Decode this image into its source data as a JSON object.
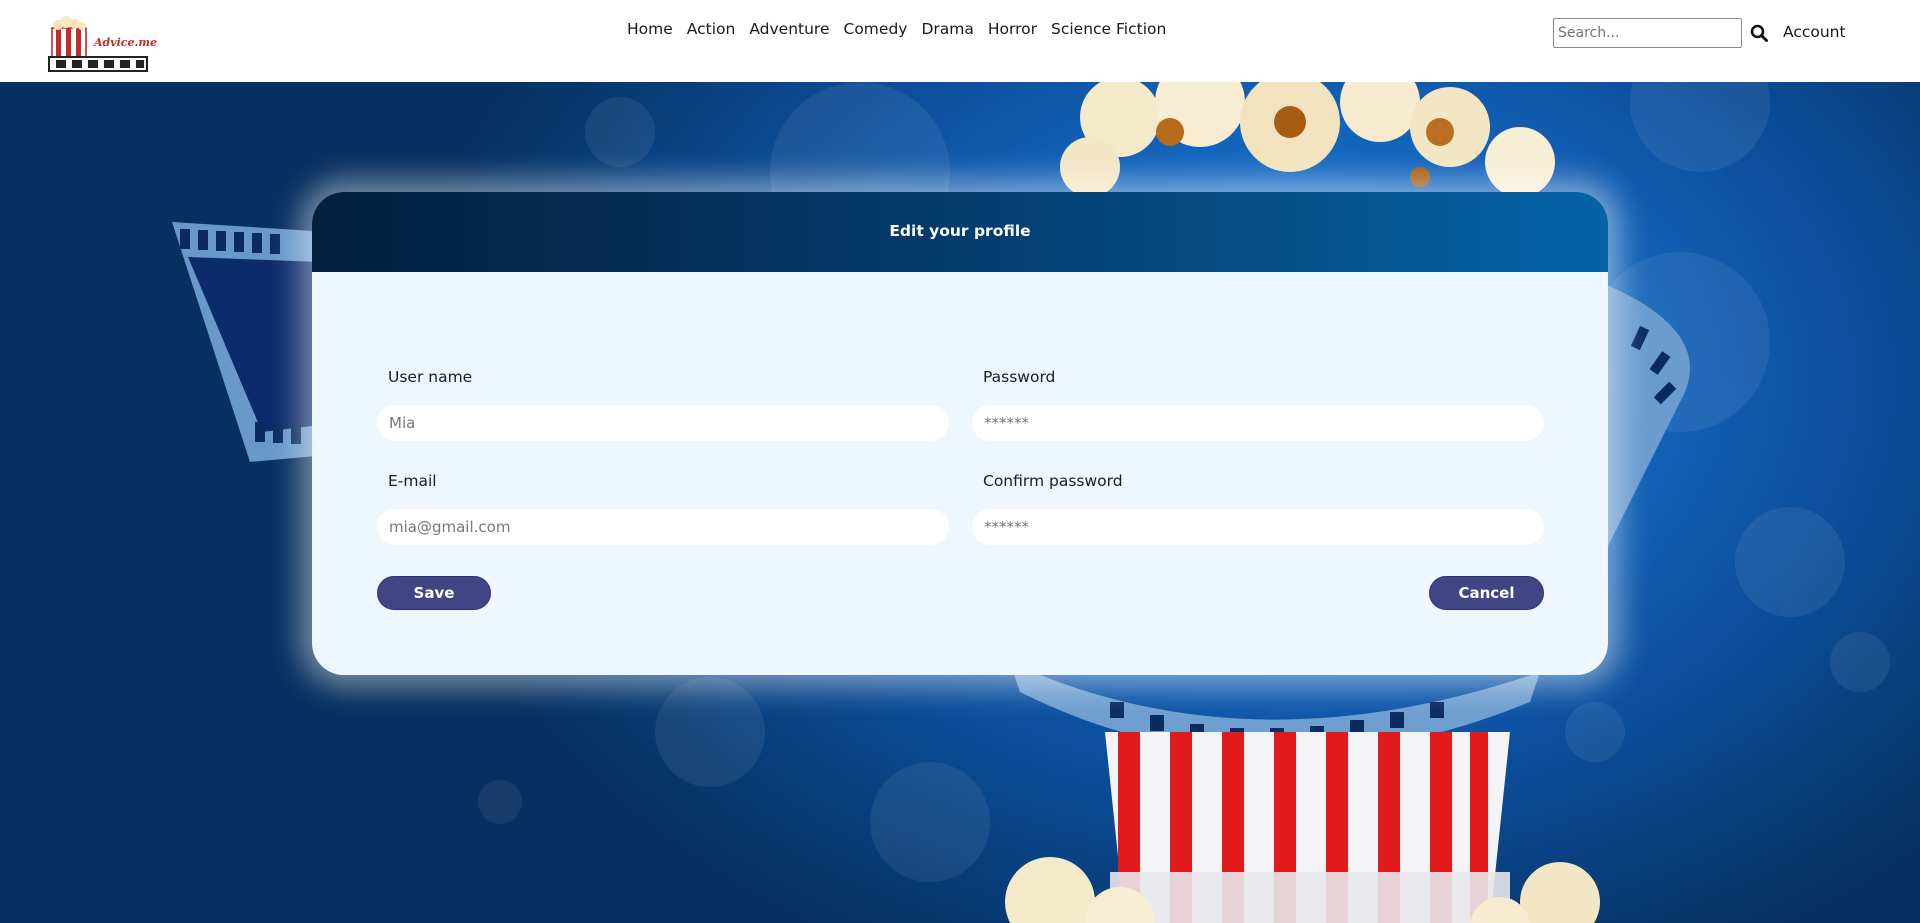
{
  "logo": {
    "text": "Advice.me"
  },
  "nav": {
    "items": [
      {
        "label": "Home"
      },
      {
        "label": "Action"
      },
      {
        "label": "Adventure"
      },
      {
        "label": "Comedy"
      },
      {
        "label": "Drama"
      },
      {
        "label": "Horror"
      },
      {
        "label": "Science Fiction"
      }
    ],
    "search_placeholder": "Search...",
    "search_icon": "search-icon",
    "account_label": "Account"
  },
  "profile_form": {
    "title": "Edit your profile",
    "username": {
      "label": "User name",
      "placeholder": "Mia"
    },
    "email": {
      "label": "E-mail",
      "placeholder": "mia@gmail.com"
    },
    "password": {
      "label": "Password",
      "placeholder": "******"
    },
    "confirm_password": {
      "label": "Confirm password",
      "placeholder": "******"
    },
    "save_label": "Save",
    "cancel_label": "Cancel"
  },
  "colors": {
    "header_dark": "#03203d",
    "header_light": "#0563a6",
    "card_background": "#eef6ff",
    "button": "#3f4585",
    "hero_blue": "#1466bf"
  }
}
